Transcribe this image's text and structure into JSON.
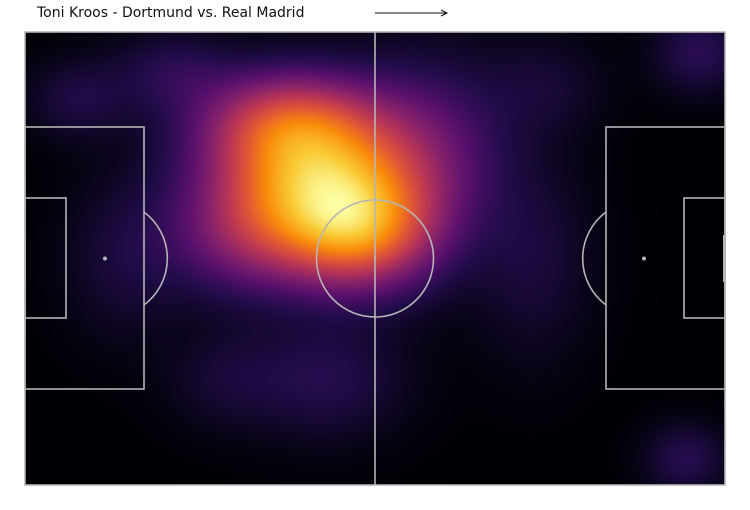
{
  "header": {
    "title": "Toni Kroos - Dortmund vs. Real Madrid",
    "attack_direction_icon": "right-arrow-icon"
  },
  "colors": {
    "pitch_lines": "#b5b5b5",
    "heatmap_colormap": "inferno",
    "background": "#000004"
  },
  "chart_data": {
    "type": "heatmap",
    "title": "Toni Kroos - Dortmund vs. Real Madrid",
    "pitch": {
      "length": 105,
      "width": 68,
      "orientation": "horizontal"
    },
    "colormap": "inferno",
    "xlim": [
      0,
      105
    ],
    "ylim": [
      0,
      68
    ],
    "grid": false,
    "legend": "none",
    "density_centers": [
      {
        "x": 43.5,
        "y": 46.5,
        "weight": 1.0,
        "spread": [
          10.5,
          7.5
        ]
      },
      {
        "x": 50,
        "y": 38,
        "weight": 0.75,
        "spread": [
          8,
          6
        ]
      },
      {
        "x": 39,
        "y": 55,
        "weight": 0.45,
        "spread": [
          9,
          5
        ]
      },
      {
        "x": 33,
        "y": 37,
        "weight": 0.3,
        "spread": [
          8,
          6
        ]
      },
      {
        "x": 61,
        "y": 51,
        "weight": 0.22,
        "spread": [
          8,
          9
        ]
      },
      {
        "x": 22,
        "y": 62,
        "weight": 0.14,
        "spread": [
          6,
          4
        ]
      },
      {
        "x": 8,
        "y": 58,
        "weight": 0.12,
        "spread": [
          5,
          4
        ]
      },
      {
        "x": 15,
        "y": 34,
        "weight": 0.1,
        "spread": [
          6,
          8
        ]
      },
      {
        "x": 45,
        "y": 16,
        "weight": 0.14,
        "spread": [
          8,
          6
        ]
      },
      {
        "x": 30,
        "y": 16,
        "weight": 0.08,
        "spread": [
          6,
          5
        ]
      },
      {
        "x": 76,
        "y": 34,
        "weight": 0.1,
        "spread": [
          6,
          10
        ]
      },
      {
        "x": 78,
        "y": 60,
        "weight": 0.08,
        "spread": [
          6,
          5
        ]
      },
      {
        "x": 101,
        "y": 65,
        "weight": 0.16,
        "spread": [
          4.5,
          4
        ]
      },
      {
        "x": 99,
        "y": 4,
        "weight": 0.15,
        "spread": [
          4,
          3.5
        ]
      }
    ]
  }
}
